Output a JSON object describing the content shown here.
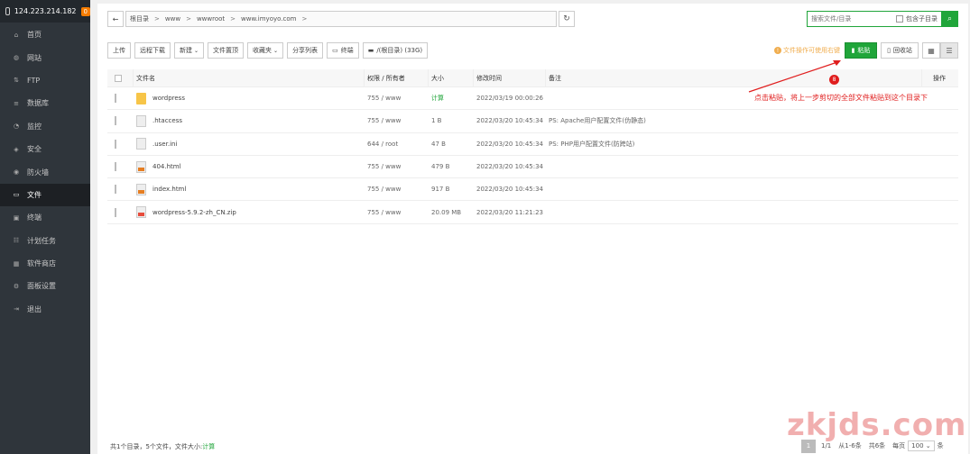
{
  "server": {
    "ip": "124.223.214.182",
    "badge": "0"
  },
  "sidebar": {
    "items": [
      {
        "label": "首页",
        "icon": "home-icon",
        "glyph": "⌂"
      },
      {
        "label": "网站",
        "icon": "globe-icon",
        "glyph": "◍"
      },
      {
        "label": "FTP",
        "icon": "ftp-icon",
        "glyph": "⇅"
      },
      {
        "label": "数据库",
        "icon": "database-icon",
        "glyph": "≡"
      },
      {
        "label": "监控",
        "icon": "monitor-icon",
        "glyph": "◔"
      },
      {
        "label": "安全",
        "icon": "shield-icon",
        "glyph": "◈"
      },
      {
        "label": "防火墙",
        "icon": "firewall-icon",
        "glyph": "◉"
      },
      {
        "label": "文件",
        "icon": "folder-icon",
        "glyph": "▭",
        "active": true
      },
      {
        "label": "终端",
        "icon": "terminal-icon",
        "glyph": "▣"
      },
      {
        "label": "计划任务",
        "icon": "schedule-icon",
        "glyph": "☷"
      },
      {
        "label": "软件商店",
        "icon": "store-icon",
        "glyph": "▦"
      },
      {
        "label": "面板设置",
        "icon": "settings-icon",
        "glyph": "⚙"
      },
      {
        "label": "退出",
        "icon": "logout-icon",
        "glyph": "⇥"
      }
    ]
  },
  "path": {
    "back": "←",
    "crumbs": [
      "根目录",
      "www",
      "wwwroot",
      "www.imyoyo.com"
    ],
    "refresh": "↻"
  },
  "search": {
    "placeholder": "搜索文件/目录",
    "subdir_label": "包含子目录",
    "icon": "⌕"
  },
  "toolbar": {
    "upload": "上传",
    "remote_download": "远程下载",
    "new": "新建",
    "favorites": "文件置顶",
    "bookmarks": "收藏夹",
    "share_list": "分享列表",
    "terminal": "终端",
    "disk": "/(根目录) (33G)"
  },
  "tip": "文件操作可使用右键",
  "paste_label": "粘贴",
  "recycle_label": "回收站",
  "table": {
    "headers": {
      "name": "文件名",
      "perm": "权限 / 所有者",
      "size": "大小",
      "time": "修改时间",
      "note": "备注",
      "op": "操作"
    },
    "rows": [
      {
        "type": "folder",
        "name": "wordpress",
        "perm": "755 / www",
        "size": "计算",
        "time": "2022/03/19 00:00:26",
        "note": ""
      },
      {
        "type": "doc",
        "name": ".htaccess",
        "perm": "755 / www",
        "size": "1 B",
        "time": "2022/03/20 10:45:34",
        "note": "PS: Apache用户配置文件(伪静态)"
      },
      {
        "type": "doc",
        "name": ".user.ini",
        "perm": "644 / root",
        "size": "47 B",
        "time": "2022/03/20 10:45:34",
        "note": "PS: PHP用户配置文件(防跨站)"
      },
      {
        "type": "html",
        "name": "404.html",
        "perm": "755 / www",
        "size": "479 B",
        "time": "2022/03/20 10:45:34",
        "note": ""
      },
      {
        "type": "html",
        "name": "index.html",
        "perm": "755 / www",
        "size": "917 B",
        "time": "2022/03/20 10:45:34",
        "note": ""
      },
      {
        "type": "zip",
        "name": "wordpress-5.9.2-zh_CN.zip",
        "perm": "755 / www",
        "size": "20.09 MB",
        "time": "2022/03/20 11:21:23",
        "note": ""
      }
    ]
  },
  "annotation": {
    "number": "8",
    "text": "点击粘贴，将上一步剪切的全部文件粘贴到这个目录下"
  },
  "footer": {
    "summary_prefix": "共1个目录，5个文件，文件大小:",
    "summary_link": "计算",
    "page_current": "1",
    "page_fraction": "1/1",
    "range": "从1-6条",
    "total": "共6条",
    "per_page_label": "每页",
    "per_page": "100",
    "per_page_unit": "条"
  },
  "watermark": "zkjds.com"
}
